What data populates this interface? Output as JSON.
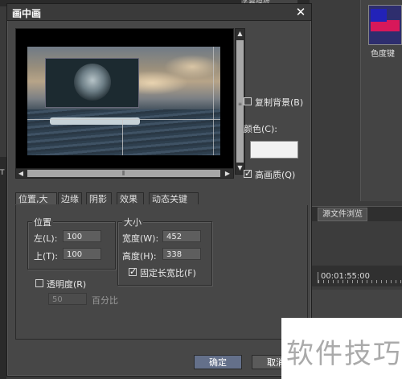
{
  "background": {
    "top_tab_label": "字幕模板",
    "thumbnail_label": "色度键",
    "source_browser_tab": "源文件浏览",
    "timecode": "00:01:55:00",
    "left_strip_label": "T"
  },
  "dialog": {
    "title": "画中画",
    "close_symbol": "✕",
    "options": {
      "copy_background": "复制背景(B)",
      "color_label": "颜色(C):",
      "color_value": "#f2f2f2",
      "high_quality": "高画质(Q)",
      "copy_background_checked": false,
      "high_quality_checked": true
    },
    "tabs": [
      "位置,大小",
      "边缘",
      "阴影",
      "效果",
      "动态关键帧"
    ],
    "active_tab": 0,
    "position": {
      "title": "位置",
      "left_label": "左(L):",
      "left_value": "100",
      "top_label": "上(T):",
      "top_value": "100"
    },
    "size": {
      "title": "大小",
      "width_label": "宽度(W):",
      "width_value": "452",
      "height_label": "高度(H):",
      "height_value": "338",
      "keep_ratio_label": "固定长宽比(F)",
      "keep_ratio_checked": true
    },
    "transparency": {
      "label": "透明度(R)",
      "checked": false,
      "value": "50",
      "unit": "百分比"
    },
    "buttons": {
      "ok": "确定",
      "cancel": "取消"
    }
  },
  "watermark": "软件技巧",
  "colors": {
    "dialog_bg": "#474747",
    "titlebar": "#3a3a3a",
    "thumb_red": "#d8185a",
    "thumb_blue": "#2222b8"
  }
}
